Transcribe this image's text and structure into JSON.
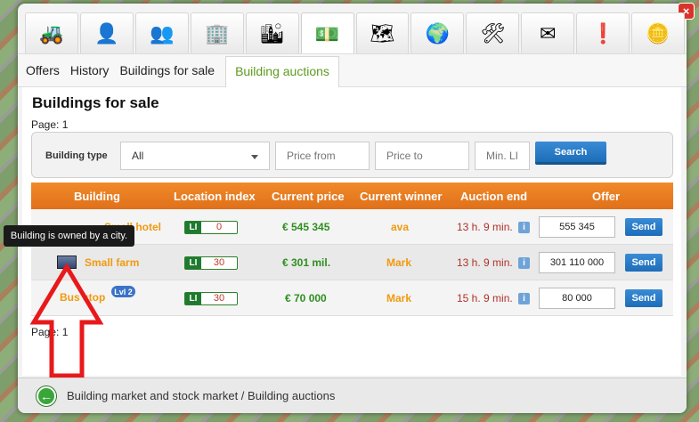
{
  "icon_tabs": [
    {
      "name": "bulldozer-icon",
      "glyph": "🚜"
    },
    {
      "name": "manager-icon",
      "glyph": "👤"
    },
    {
      "name": "people-icon",
      "glyph": "👥"
    },
    {
      "name": "skyscraper-icon",
      "glyph": "🏢"
    },
    {
      "name": "buildings-icon",
      "glyph": "🏙"
    },
    {
      "name": "money-building-icon",
      "glyph": "💵"
    },
    {
      "name": "map-key-icon",
      "glyph": "🗺"
    },
    {
      "name": "globe-icon",
      "glyph": "🌍"
    },
    {
      "name": "tools-icon",
      "glyph": "🛠"
    },
    {
      "name": "mail-icon",
      "glyph": "✉"
    },
    {
      "name": "alert-icon",
      "glyph": "❗"
    },
    {
      "name": "coin-icon",
      "glyph": "🪙"
    }
  ],
  "active_icon_tab": 5,
  "close_label": "×",
  "sub_tabs": [
    "Offers",
    "History",
    "Buildings for sale",
    "Building auctions"
  ],
  "active_sub_tab": 3,
  "title": "Buildings for sale",
  "page_top": "Page: 1",
  "page_bottom": "Page: 1",
  "filters": {
    "label": "Building type",
    "building_type_value": "All",
    "price_from_placeholder": "Price from",
    "price_to_placeholder": "Price to",
    "min_li_placeholder": "Min. LI",
    "search_label": "Search"
  },
  "table": {
    "headers": [
      "Building",
      "Location index",
      "Current price",
      "Current winner",
      "Auction end",
      "Offer"
    ],
    "li_tag": "LI",
    "info_glyph": "i",
    "send_label": "Send",
    "rows": [
      {
        "building": "Small hotel",
        "li": "0",
        "price": "€ 545 345",
        "winner": "ava",
        "end": "13 h. 9 min.",
        "offer": "555 345"
      },
      {
        "building": "Small farm",
        "li": "30",
        "price": "€ 301 mil.",
        "winner": "Mark",
        "end": "13 h. 9 min.",
        "offer": "301 110 000"
      },
      {
        "building": "Bus stop",
        "li": "30",
        "price": "€ 70 000",
        "winner": "Mark",
        "end": "15 h. 9 min.",
        "offer": "80 000",
        "level": "Lvl 2"
      }
    ]
  },
  "tooltip": "Building is owned by a city.",
  "breadcrumb": "Building market and stock market / Building auctions",
  "colors": {
    "accent_orange": "#e0701a",
    "active_tab_green": "#5e9b1f",
    "send_blue": "#1d6db8",
    "annotation_red": "#e8191b"
  }
}
